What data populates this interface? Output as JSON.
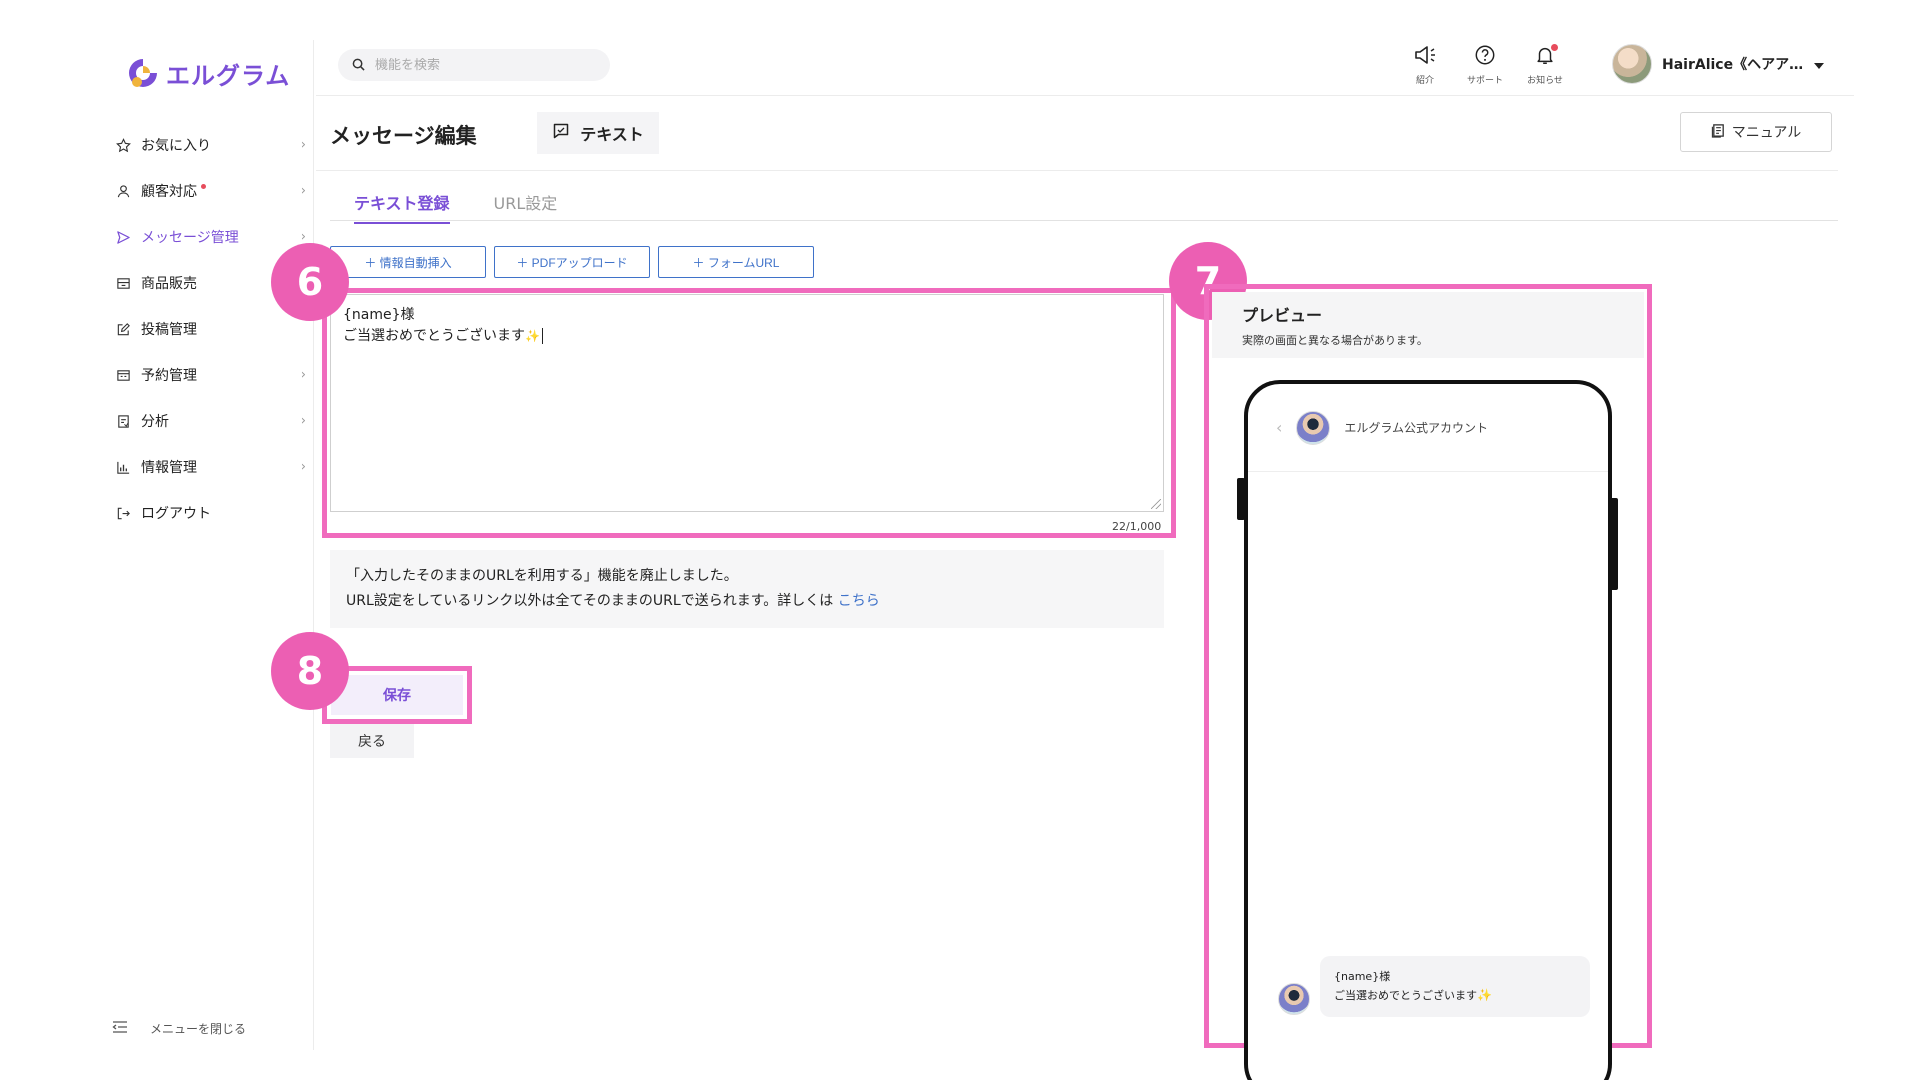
{
  "app": {
    "logo_text": "エルグラム"
  },
  "sidebar": {
    "items": [
      {
        "label": "お気に入り",
        "icon": "star-icon",
        "has_chevron": true
      },
      {
        "label": "顧客対応",
        "icon": "user-icon",
        "has_chevron": true,
        "badge": "red-dot"
      },
      {
        "label": "メッセージ管理",
        "icon": "send-icon",
        "has_chevron": true,
        "active": true
      },
      {
        "label": "商品販売",
        "icon": "store-icon",
        "has_chevron": false
      },
      {
        "label": "投稿管理",
        "icon": "edit-icon",
        "has_chevron": false
      },
      {
        "label": "予約管理",
        "icon": "calendar-icon",
        "has_chevron": true
      },
      {
        "label": "分析",
        "icon": "report-icon",
        "has_chevron": true
      },
      {
        "label": "情報管理",
        "icon": "chart-icon",
        "has_chevron": true
      },
      {
        "label": "ログアウト",
        "icon": "logout-icon",
        "has_chevron": false
      }
    ],
    "close_menu_label": "メニューを閉じる"
  },
  "topbar": {
    "search_placeholder": "機能を検索",
    "icons": [
      {
        "label": "紹介",
        "icon": "megaphone-icon"
      },
      {
        "label": "サポート",
        "icon": "help-icon"
      },
      {
        "label": "お知らせ",
        "icon": "bell-icon"
      }
    ],
    "user_name": "HairAlice《ヘアア…"
  },
  "page": {
    "title": "メッセージ編集",
    "type_label": "テキスト",
    "manual_label": "マニュアル"
  },
  "tabs": [
    {
      "label": "テキスト登録",
      "active": true
    },
    {
      "label": "URL設定",
      "active": false
    }
  ],
  "insert_buttons": [
    {
      "label": "＋ 情報自動挿入"
    },
    {
      "label": "＋ PDFアップロード"
    },
    {
      "label": "＋ フォームURL"
    }
  ],
  "editor": {
    "line1": "{name}様",
    "line2": "ご当選おめでとうございます",
    "sparkle": "✨",
    "char_count": "22/1,000"
  },
  "notice": {
    "line1": "「入力したそのままのURLを利用する」機能を廃止しました。",
    "line2": "URL設定をしているリンク以外は全てそのままのURLで送られます。詳しくは",
    "link": "こちら"
  },
  "actions": {
    "save_label": "保存",
    "back_label": "戻る"
  },
  "markers": [
    "6",
    "7",
    "8"
  ],
  "preview": {
    "title": "プレビュー",
    "note": "実際の画面と異なる場合があります。",
    "account_name": "エルグラム公式アカウント",
    "message_line1": "{name}様",
    "message_line2": "ご当選おめでとうございます",
    "sparkle": "✨"
  },
  "colors": {
    "accent": "#7a4fd6",
    "link": "#3f72c9",
    "highlight": "#f06bbd",
    "marker": "#ec5fb3"
  }
}
